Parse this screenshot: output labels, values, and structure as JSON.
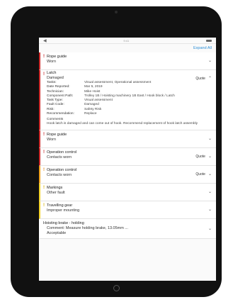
{
  "screen": {
    "status_left": "◀",
    "status_time": "9:41",
    "expand_all": "Expand All"
  },
  "items": [
    {
      "title": "Rope guide",
      "subtitle": "Worn",
      "severity": "#cc2b2b"
    },
    {
      "title": "Latch",
      "subtitle": "Damaged",
      "quote": "Quote",
      "severity": "#cc2b2b",
      "details": [
        {
          "label": "Tasks:",
          "value": "Visual assessment, Operational assessment"
        },
        {
          "label": "Date Reported:",
          "value": "Mar 5, 2019"
        },
        {
          "label": "Technician:",
          "value": "Mike Hoist"
        },
        {
          "label": "Component Path:",
          "value": "Trolley 1B / Hoisting machinery 1B East / Hook block / Latch"
        },
        {
          "label": "Task Type:",
          "value": "Visual assessment"
        },
        {
          "label": "Fault Code:",
          "value": "Damaged"
        },
        {
          "label": "Risk:",
          "value": "Safety Risk"
        },
        {
          "label": "Recommendation:",
          "value": "Replace"
        }
      ],
      "comments_label": "Comments",
      "comments_text": "Hook latch is damaged and can come out of hook. Recommend replacement of hook latch assembly"
    },
    {
      "title": "Rope guide",
      "subtitle": "Worn",
      "severity": "#cc2b2b"
    },
    {
      "title": "Operation control",
      "subtitle": "Contacts worn",
      "quote": "Quote",
      "severity": "#cc2b2b"
    },
    {
      "title": "Operation control",
      "subtitle": "Contacts worn",
      "quote": "Quote",
      "severity": "#f0a21e"
    },
    {
      "title": "Markings",
      "subtitle": "Other fault",
      "severity": "#f3d22b"
    },
    {
      "title": "Travelling gear",
      "subtitle": "Improper mounting",
      "severity": "#f3d22b"
    },
    {
      "title": "Hoisting brake - holding",
      "subtitle": "Comment: Measure holding brake, 13.05mm ...",
      "subtitle2": "Acceptable"
    }
  ],
  "icons": {
    "alert": "!",
    "chevron_down": "⌄",
    "chevron_up": "⌃"
  }
}
